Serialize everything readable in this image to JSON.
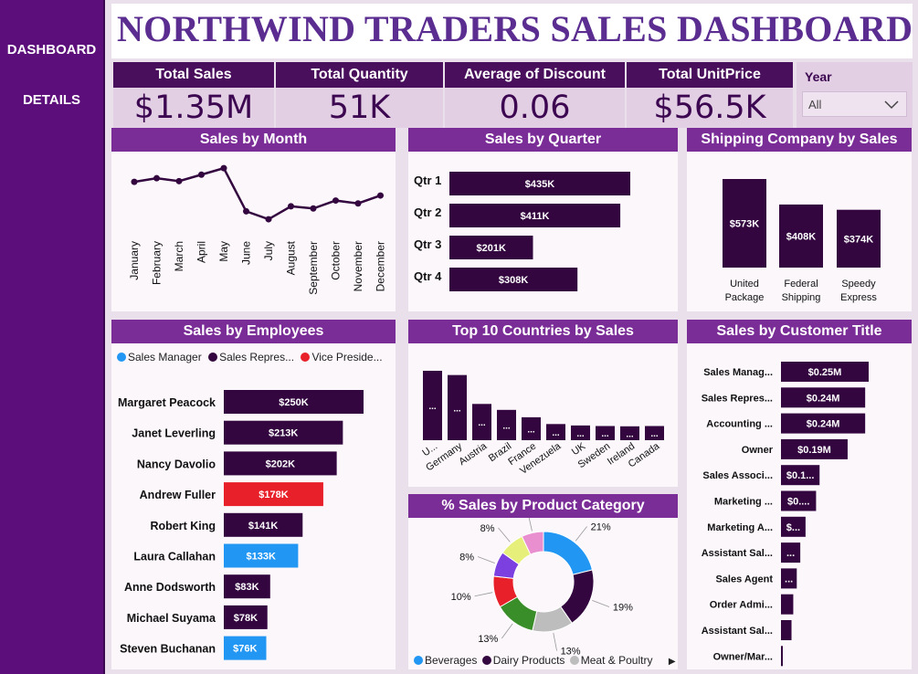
{
  "nav": {
    "dashboard": "DASHBOARD",
    "details": "DETAILS"
  },
  "title": "NORTHWIND TRADERS SALES DASHBOARD",
  "kpis": [
    {
      "label": "Total Sales",
      "value": "$1.35M"
    },
    {
      "label": "Total Quantity",
      "value": "51K"
    },
    {
      "label": "Average of Discount",
      "value": "0.06"
    },
    {
      "label": "Total UnitPrice",
      "value": "$56.5K"
    }
  ],
  "year_filter": {
    "label": "Year",
    "selected": "All"
  },
  "colors": {
    "dark": "#33063f",
    "red": "#e8202a",
    "blue": "#2196f3"
  },
  "panels": {
    "month": "Sales by Month",
    "quarter": "Sales by Quarter",
    "shipping": "Shipping Company by Sales",
    "employees": "Sales by Employees",
    "countries": "Top 10 Countries by Sales",
    "customer_title": "Sales by Customer Title",
    "category": "% Sales by Product Category"
  },
  "employees_legend": [
    {
      "label": "Sales Manager",
      "color": "#2196f3"
    },
    {
      "label": "Sales Repres...",
      "color": "#33063f"
    },
    {
      "label": "Vice Preside...",
      "color": "#e8202a"
    }
  ],
  "category_legend": [
    {
      "label": "Beverages",
      "color": "#2196f3"
    },
    {
      "label": "Dairy Products",
      "color": "#33063f"
    },
    {
      "label": "Meat & Poultry",
      "color": "#bdbdbd"
    }
  ],
  "chart_data": [
    {
      "type": "line",
      "title": "Sales by Month",
      "categories": [
        "January",
        "February",
        "March",
        "April",
        "May",
        "June",
        "July",
        "August",
        "September",
        "October",
        "November",
        "December"
      ],
      "values": [
        112,
        117,
        113,
        122,
        131,
        71,
        60,
        78,
        75,
        86,
        82,
        93
      ]
    },
    {
      "type": "bar",
      "orientation": "horizontal",
      "title": "Sales by Quarter",
      "categories": [
        "Qtr 1",
        "Qtr 2",
        "Qtr 3",
        "Qtr 4"
      ],
      "values": [
        435,
        411,
        201,
        308
      ],
      "labels": [
        "$435K",
        "$411K",
        "$201K",
        "$308K"
      ]
    },
    {
      "type": "bar",
      "title": "Shipping Company by Sales",
      "categories": [
        "United Package",
        "Federal Shipping",
        "Speedy Express"
      ],
      "values": [
        573,
        408,
        374
      ],
      "labels": [
        "$573K",
        "$408K",
        "$374K"
      ]
    },
    {
      "type": "bar",
      "orientation": "horizontal",
      "title": "Sales by Employees",
      "categories": [
        "Margaret Peacock",
        "Janet Leverling",
        "Nancy Davolio",
        "Andrew Fuller",
        "Robert King",
        "Laura Callahan",
        "Anne Dodsworth",
        "Michael Suyama",
        "Steven Buchanan"
      ],
      "values": [
        250,
        213,
        202,
        178,
        141,
        133,
        83,
        78,
        76
      ],
      "labels": [
        "$250K",
        "$213K",
        "$202K",
        "$178K",
        "$141K",
        "$133K",
        "$83K",
        "$78K",
        "$76K"
      ],
      "roles": [
        "Sales Repres...",
        "Sales Repres...",
        "Sales Repres...",
        "Vice Preside...",
        "Sales Repres...",
        "Sales Manager",
        "Sales Repres...",
        "Sales Repres...",
        "Sales Manager"
      ]
    },
    {
      "type": "bar",
      "title": "Top 10 Countries by Sales",
      "categories": [
        "U...",
        "Germany",
        "Austria",
        "Brazil",
        "France",
        "Venezuela",
        "UK",
        "Sweden",
        "Ireland",
        "Canada"
      ],
      "values": [
        245,
        230,
        128,
        107,
        81,
        57,
        52,
        50,
        49,
        50
      ],
      "labels": [
        "...",
        "...",
        "...",
        "...",
        "...",
        "...",
        "...",
        "...",
        "...",
        "..."
      ]
    },
    {
      "type": "pie",
      "title": "% Sales by Product Category",
      "labels": [
        "21%",
        "19%",
        "13%",
        "13%",
        "10%",
        "8%",
        "8%",
        "7%"
      ],
      "values": [
        21,
        19,
        13,
        13,
        10,
        8,
        8,
        7
      ],
      "colors": [
        "#2196f3",
        "#33063f",
        "#bdbdbd",
        "#3a8e2a",
        "#e8202a",
        "#7c3fe0",
        "#e6ef7a",
        "#e98fcf"
      ]
    },
    {
      "type": "bar",
      "orientation": "horizontal",
      "title": "Sales by Customer Title",
      "categories": [
        "Sales Manag...",
        "Sales Repres...",
        "Accounting ...",
        "Owner",
        "Sales Associ...",
        "Marketing ...",
        "Marketing A...",
        "Assistant Sal...",
        "Sales Agent",
        "Order Admi...",
        "Assistant Sal...",
        "Owner/Mar..."
      ],
      "values": [
        0.25,
        0.24,
        0.24,
        0.19,
        0.11,
        0.1,
        0.07,
        0.055,
        0.045,
        0.035,
        0.03,
        0.005
      ],
      "labels": [
        "$0.25M",
        "$0.24M",
        "$0.24M",
        "$0.19M",
        "$0.1...",
        "$0....",
        "$...",
        "...",
        "...",
        "",
        "",
        ""
      ]
    }
  ]
}
